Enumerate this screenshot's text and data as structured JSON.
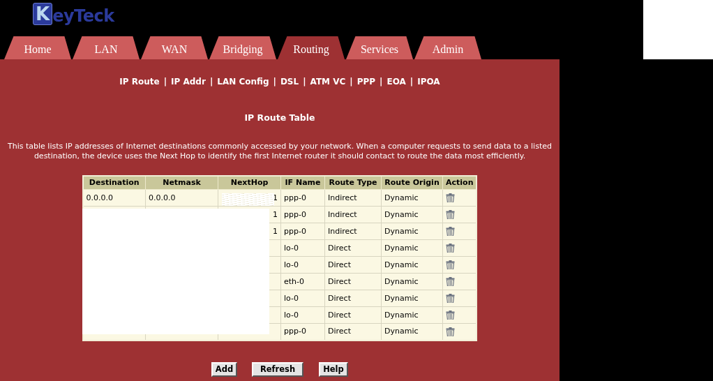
{
  "logo": {
    "initial": "K",
    "rest": "eyTeck"
  },
  "tabs": [
    {
      "label": "Home",
      "selected": false
    },
    {
      "label": "LAN",
      "selected": false
    },
    {
      "label": "WAN",
      "selected": false
    },
    {
      "label": "Bridging",
      "selected": false
    },
    {
      "label": "Routing",
      "selected": true
    },
    {
      "label": "Services",
      "selected": false
    },
    {
      "label": "Admin",
      "selected": false
    }
  ],
  "subnav": {
    "separator": "|",
    "items": [
      "IP Route",
      "IP Addr",
      "LAN Config",
      "DSL",
      "ATM VC",
      "PPP",
      "EOA",
      "IPOA"
    ]
  },
  "title": "IP Route Table",
  "description": "This table lists IP addresses of Internet destinations commonly accessed by your network. When a computer requests to send data to a listed destination, the device uses the Next Hop to identify the first Internet router it should contact to route the data most efficiently.",
  "table": {
    "columns": [
      "Destination",
      "Netmask",
      "NextHop",
      "IF Name",
      "Route Type",
      "Route Origin",
      "Action"
    ],
    "rows": [
      {
        "destination": "0.0.0.0",
        "netmask": "0.0.0.0",
        "nexthop": "1",
        "if_name": "ppp-0",
        "route_type": "Indirect",
        "route_origin": "Dynamic"
      },
      {
        "nexthop": "1",
        "if_name": "ppp-0",
        "route_type": "Indirect",
        "route_origin": "Dynamic"
      },
      {
        "nexthop": "1",
        "if_name": "ppp-0",
        "route_type": "Indirect",
        "route_origin": "Dynamic"
      },
      {
        "if_name": "lo-0",
        "route_type": "Direct",
        "route_origin": "Dynamic"
      },
      {
        "if_name": "lo-0",
        "route_type": "Direct",
        "route_origin": "Dynamic"
      },
      {
        "if_name": "eth-0",
        "route_type": "Direct",
        "route_origin": "Dynamic"
      },
      {
        "if_name": "lo-0",
        "route_type": "Direct",
        "route_origin": "Dynamic"
      },
      {
        "if_name": "lo-0",
        "route_type": "Direct",
        "route_origin": "Dynamic"
      },
      {
        "if_name": "ppp-0",
        "route_type": "Direct",
        "route_origin": "Dynamic"
      }
    ]
  },
  "buttons": [
    "Add",
    "Refresh",
    "Help"
  ]
}
